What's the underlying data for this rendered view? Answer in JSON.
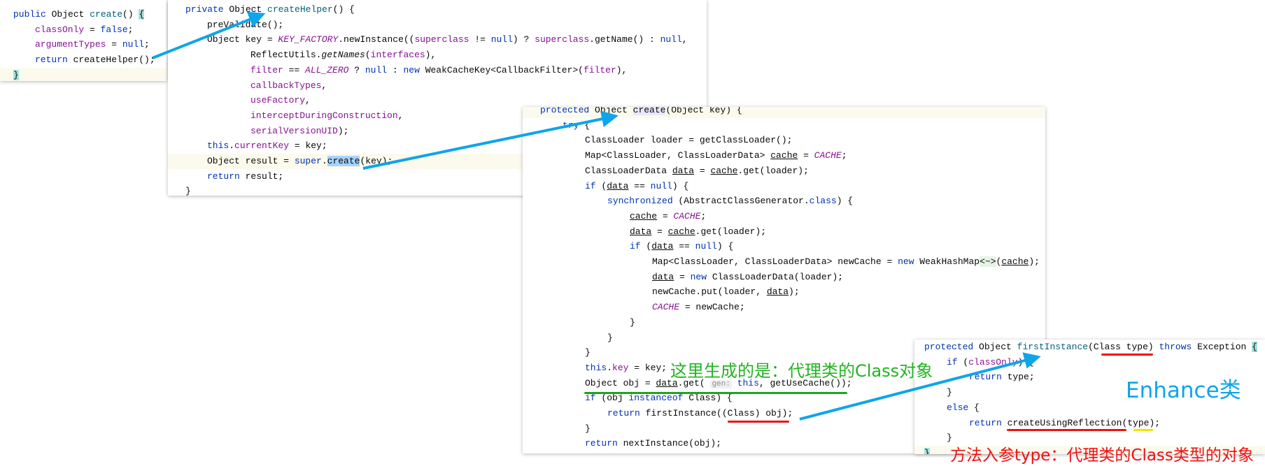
{
  "colors": {
    "arrow": "#0ea5e9",
    "green_note": "#22b422",
    "blue_note": "#0ea5e9",
    "red_note": "#ee1111",
    "underline_red": "#e11",
    "underline_green": "#1fa51f",
    "underline_yellow": "#f2e600"
  },
  "panels": [
    {
      "id": "enhancer-create",
      "lines": [
        {
          "ind": 0,
          "t": [
            [
              "public",
              "k"
            ],
            " Object ",
            [
              "create",
              "m"
            ],
            "() ",
            [
              "{",
              "bm"
            ]
          ]
        },
        {
          "ind": 1,
          "t": [
            [
              "classOnly",
              "f"
            ],
            " = ",
            [
              "false",
              "k"
            ],
            ";"
          ]
        },
        {
          "ind": 1,
          "t": [
            [
              "argumentTypes",
              "f"
            ],
            " = ",
            [
              "null",
              "k"
            ],
            ";"
          ]
        },
        {
          "ind": 1,
          "t": [
            [
              "return",
              "k"
            ],
            " createHelper();"
          ]
        },
        {
          "ind": 0,
          "cur": true,
          "t": [
            [
              "}",
              "bm"
            ]
          ]
        }
      ]
    },
    {
      "id": "create-helper",
      "lines": [
        {
          "ind": 0,
          "t": [
            [
              "private",
              "k"
            ],
            " Object ",
            [
              "createHelper",
              "m"
            ],
            "() {"
          ]
        },
        {
          "ind": 1,
          "t": [
            "preValidate();"
          ]
        },
        {
          "ind": 1,
          "t": [
            "Object key = ",
            [
              "KEY_FACTORY",
              "s"
            ],
            ".newInstance((",
            [
              "superclass",
              "f"
            ],
            " != ",
            [
              "null",
              "k"
            ],
            ") ? ",
            [
              "superclass",
              "f"
            ],
            ".getName() : ",
            [
              "null",
              "k"
            ],
            ","
          ]
        },
        {
          "ind": 3,
          "t": [
            "ReflectUtils.",
            [
              "getNames",
              "i"
            ],
            "(",
            [
              "interfaces",
              "f"
            ],
            "),"
          ]
        },
        {
          "ind": 3,
          "t": [
            [
              "filter",
              "f"
            ],
            " == ",
            [
              "ALL_ZERO",
              "s"
            ],
            " ? ",
            [
              "null",
              "k"
            ],
            " : ",
            [
              "new",
              "k"
            ],
            " WeakCacheKey<CallbackFilter>(",
            [
              "filter",
              "f"
            ],
            "),"
          ]
        },
        {
          "ind": 3,
          "t": [
            [
              "callbackTypes",
              "f"
            ],
            ","
          ]
        },
        {
          "ind": 3,
          "t": [
            [
              "useFactory",
              "f"
            ],
            ","
          ]
        },
        {
          "ind": 3,
          "t": [
            [
              "interceptDuringConstruction",
              "f"
            ],
            ","
          ]
        },
        {
          "ind": 3,
          "t": [
            [
              "serialVersionUID",
              "f"
            ],
            ");"
          ]
        },
        {
          "ind": 1,
          "t": [
            [
              "this",
              "k"
            ],
            ".",
            [
              "currentKey",
              "f"
            ],
            " = key;"
          ]
        },
        {
          "ind": 1,
          "cur": true,
          "t": [
            "Object result = ",
            [
              "super",
              "k"
            ],
            ".",
            [
              "create",
              "sel"
            ],
            "(key);"
          ]
        },
        {
          "ind": 1,
          "t": [
            [
              "return",
              "k"
            ],
            " result;"
          ]
        },
        {
          "ind": 0,
          "t": [
            "}"
          ]
        }
      ]
    },
    {
      "id": "abstract-class-generator-create",
      "lines": [
        {
          "ind": 0,
          "cur": true,
          "t": [
            [
              "protected",
              "k"
            ],
            " Object ",
            [
              "create",
              "hl"
            ],
            "(Object key) {"
          ]
        },
        {
          "ind": 1,
          "t": [
            [
              "try",
              "k"
            ],
            " {"
          ]
        },
        {
          "ind": 2,
          "t": [
            "ClassLoader loader = getClassLoader();"
          ]
        },
        {
          "ind": 2,
          "t": [
            "Map<ClassLoader, ClassLoaderData> ",
            [
              "cache",
              "u"
            ],
            " = ",
            [
              "CACHE",
              "s"
            ],
            ";"
          ]
        },
        {
          "ind": 2,
          "t": [
            "ClassLoaderData ",
            [
              "data",
              "u"
            ],
            " = ",
            [
              "cache",
              "u"
            ],
            ".get(loader);"
          ]
        },
        {
          "ind": 2,
          "t": [
            [
              "if",
              "k"
            ],
            " (",
            [
              "data",
              "u"
            ],
            " == ",
            [
              "null",
              "k"
            ],
            ") {"
          ]
        },
        {
          "ind": 3,
          "t": [
            [
              "synchronized",
              "k"
            ],
            " (AbstractClassGenerator.",
            [
              "class",
              "k"
            ],
            ") {"
          ]
        },
        {
          "ind": 4,
          "t": [
            [
              "cache",
              "u"
            ],
            " = ",
            [
              "CACHE",
              "s"
            ],
            ";"
          ]
        },
        {
          "ind": 4,
          "t": [
            [
              "data",
              "u"
            ],
            " = ",
            [
              "cache",
              "u"
            ],
            ".get(loader);"
          ]
        },
        {
          "ind": 4,
          "t": [
            [
              "if",
              "k"
            ],
            " (",
            [
              "data",
              "u"
            ],
            " == ",
            [
              "null",
              "k"
            ],
            ") {"
          ]
        },
        {
          "ind": 5,
          "t": [
            "Map<ClassLoader, ClassLoaderData> newCache = ",
            [
              "new",
              "k"
            ],
            " WeakHashMap",
            [
              "<~>",
              "gen"
            ],
            "(",
            [
              "cache",
              "u"
            ],
            ");"
          ]
        },
        {
          "ind": 5,
          "t": [
            [
              "data",
              "u"
            ],
            " = ",
            [
              "new",
              "k"
            ],
            " ClassLoaderData(loader);"
          ]
        },
        {
          "ind": 5,
          "t": [
            "newCache.put(loader, ",
            [
              "data",
              "u"
            ],
            ");"
          ]
        },
        {
          "ind": 5,
          "t": [
            [
              "CACHE",
              "s"
            ],
            " = newCache;"
          ]
        },
        {
          "ind": 4,
          "t": [
            "}"
          ]
        },
        {
          "ind": 3,
          "t": [
            "}"
          ]
        },
        {
          "ind": 2,
          "t": [
            "}"
          ]
        },
        {
          "ind": 2,
          "t": [
            [
              "this",
              "k"
            ],
            ".",
            [
              "key",
              "f"
            ],
            " = key;"
          ]
        },
        {
          "ind": 2,
          "t": [
            "Object obj = ",
            [
              "data",
              "u"
            ],
            ".get( ",
            [
              "gen:",
              "h"
            ],
            " ",
            [
              "this",
              "k"
            ],
            ", getUseCache());"
          ]
        },
        {
          "ind": 2,
          "t": [
            [
              "if",
              "k"
            ],
            " (obj ",
            [
              "instanceof",
              "k"
            ],
            " Class) {"
          ]
        },
        {
          "ind": 3,
          "t": [
            [
              "return",
              "k"
            ],
            " firstInstance((Class) obj);"
          ]
        },
        {
          "ind": 2,
          "t": [
            "}"
          ]
        },
        {
          "ind": 2,
          "t": [
            [
              "return",
              "k"
            ],
            " nextInstance(obj);"
          ]
        }
      ]
    },
    {
      "id": "first-instance",
      "lines": [
        {
          "ind": 0,
          "t": [
            [
              "protected",
              "k"
            ],
            " Object ",
            [
              "firstInstance",
              "m"
            ],
            "(Class type) ",
            [
              "throws",
              "k"
            ],
            " Exception ",
            [
              "{",
              "bm"
            ]
          ]
        },
        {
          "ind": 1,
          "t": [
            [
              "if",
              "k"
            ],
            " (",
            [
              "classOnly",
              "f"
            ],
            ") {"
          ]
        },
        {
          "ind": 2,
          "t": [
            [
              "return",
              "k"
            ],
            " type;"
          ]
        },
        {
          "ind": 1,
          "t": [
            "}"
          ]
        },
        {
          "ind": 1,
          "t": [
            [
              "else",
              "k"
            ],
            " {"
          ]
        },
        {
          "ind": 2,
          "t": [
            [
              "return",
              "k"
            ],
            " createUsingReflection(type);"
          ]
        },
        {
          "ind": 1,
          "t": [
            "}"
          ]
        },
        {
          "ind": 0,
          "cur": true,
          "t": [
            [
              "}",
              "bm"
            ]
          ]
        }
      ]
    }
  ],
  "annotations": {
    "green": "这里生成的是：代理类的Class对象",
    "blue": "Enhance类",
    "red": "方法入参type：代理类的Class类型的对象"
  }
}
